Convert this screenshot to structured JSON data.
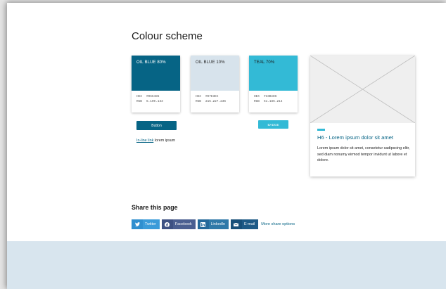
{
  "colour_scheme": {
    "title": "Colour scheme",
    "swatches": [
      {
        "name": "OIL BLUE 80%",
        "hex_label": "HEX",
        "hex": "#066485",
        "rgb_label": "RGB",
        "rgb": "6.100.133",
        "color": "#066485",
        "text_color": "#ffffff"
      },
      {
        "name": "OIL BLUE 10%",
        "hex_label": "HEX",
        "hex": "#D7E3EC",
        "rgb_label": "RGB",
        "rgb": "215.227.236",
        "color": "#D7E3EC",
        "text_color": "#2a2a2a"
      },
      {
        "name": "TEAL 70%",
        "hex_label": "HEX",
        "hex": "#33BAD6",
        "rgb_label": "RGB",
        "rgb": "51.186.214",
        "color": "#33BAD6",
        "text_color": "#1a1a1a"
      }
    ],
    "button_label": "Button",
    "badge_label": "BADGE",
    "inline_link_label": "In-line link",
    "inline_text": " lorem ipsum"
  },
  "card": {
    "title": "H6 - Lorem ipsum dolor sit amet",
    "body": "Lorem ipsum dolor sit amet, consetetur sadipscing elitr, sed diam nonumy eirmod tempor invidunt ut labore et dolore.",
    "image_icon": "image-placeholder-icon"
  },
  "share": {
    "heading": "Share this page",
    "buttons": [
      {
        "label": "Twitter",
        "icon": "twitter-icon",
        "glyph": "🐦",
        "color": "#3b9bd9",
        "icon_bg": "#2f8fcf"
      },
      {
        "label": "Facebook",
        "icon": "facebook-icon",
        "glyph": "f",
        "color": "#4a5f91",
        "icon_bg": "#3d5183"
      },
      {
        "label": "LinkedIn",
        "icon": "linkedin-icon",
        "glyph": "in",
        "color": "#2f79a8",
        "icon_bg": "#25699a"
      },
      {
        "label": "E-mail",
        "icon": "email-icon",
        "glyph": "✉",
        "color": "#1e5a86",
        "icon_bg": "#174f79"
      }
    ],
    "more_label": "More share options"
  },
  "colors": {
    "footer": "#d8e5ee",
    "accent": "#066485",
    "teal": "#33BAD6"
  }
}
